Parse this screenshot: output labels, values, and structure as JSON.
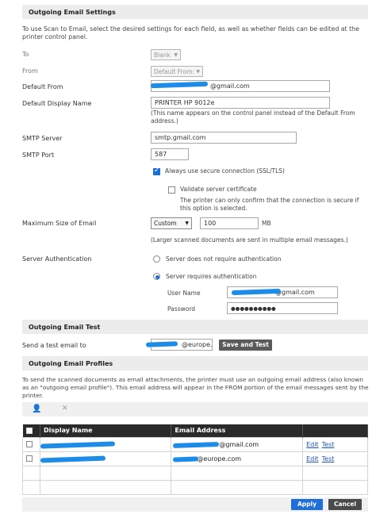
{
  "outgoing_settings": {
    "header": "Outgoing Email Settings",
    "intro": "To use Scan to Email, select the desired settings for each field, as well as whether fields can be edited at the printer control panel.",
    "to_label": "To",
    "to_value": "Blank",
    "from_label": "From",
    "from_value": "Default From:",
    "default_from_label": "Default From",
    "default_from_value": "@gmail.com",
    "display_name_label": "Default Display Name",
    "display_name_value": "PRINTER HP 9012e",
    "display_name_note": "(This name appears on the control panel instead of the Default From address.)",
    "smtp_server_label": "SMTP Server",
    "smtp_server_value": "smtp.gmail.com",
    "smtp_port_label": "SMTP Port",
    "smtp_port_value": "587",
    "ssl_label": "Always use secure connection (SSL/TLS)",
    "validate_label": "Validate server certificate",
    "validate_note": "The printer can only confirm that the connection is secure if this option is selected.",
    "max_size_label": "Maximum Size of Email",
    "max_size_mode": "Custom",
    "max_size_value": "100",
    "max_size_unit": "MB",
    "max_size_note": "(Larger scanned documents are sent in multiple email messages.)",
    "auth_label": "Server Authentication",
    "auth_option_none": "Server does not require authentication",
    "auth_option_required": "Server requires authentication",
    "username_label": "User Name",
    "username_value": "@gmail.com",
    "password_label": "Password",
    "password_value": "●●●●●●●●●●"
  },
  "test": {
    "header": "Outgoing Email Test",
    "send_label": "Send a test email to",
    "send_value": "@europe.",
    "button": "Save and Test"
  },
  "profiles": {
    "header": "Outgoing Email Profiles",
    "intro": "To send the scanned documents as email attachments, the printer must use an outgoing email address (also known as an \"outgoing email profile\"). This email address will appear in the FROM portion of the email messages sent by the printer.",
    "col_display": "Display Name",
    "col_email": "Email Address",
    "rows": [
      {
        "display": "",
        "email": "@gmail.com",
        "edit": "Edit",
        "test": "Test"
      },
      {
        "display": "",
        "email": "@europe.com",
        "edit": "Edit",
        "test": "Test"
      }
    ]
  },
  "footer": {
    "apply": "Apply",
    "cancel": "Cancel"
  },
  "colors": {
    "accent": "#1e6fd9",
    "header_bg": "#2a2a2a",
    "redaction": "#1d8ce8"
  }
}
